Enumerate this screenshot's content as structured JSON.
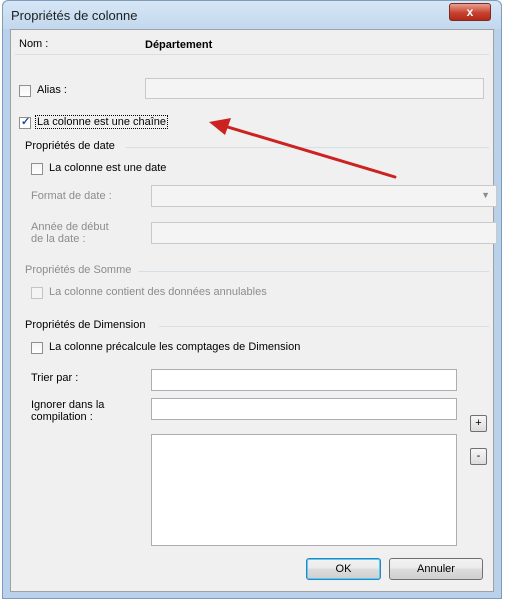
{
  "window": {
    "title": "Propriétés de colonne",
    "close_glyph": "x"
  },
  "name_row": {
    "label": "Nom :",
    "value": "Département"
  },
  "alias": {
    "label": "Alias :",
    "checked": false,
    "value": ""
  },
  "string_checkbox": {
    "label": "La colonne est une chaîne",
    "checked": true
  },
  "date_group": {
    "heading": "Propriétés de date",
    "is_date_label": "La colonne est une date",
    "format_label": "Format de date :",
    "format_value": "",
    "start_year_label_1": "Année de début",
    "start_year_label_2": "de la date :",
    "start_year_value": ""
  },
  "sum_group": {
    "heading": "Propriétés de Somme",
    "nullable_label": "La colonne contient des données annulables"
  },
  "dimension_group": {
    "heading": "Propriétés de Dimension",
    "precalc_label": "La colonne précalcule les comptages de Dimension",
    "sort_label": "Trier par :",
    "sort_value": "",
    "ignore_label_1": "Ignorer dans la",
    "ignore_label_2": "compilation :",
    "ignore_value": "",
    "add_glyph": "+",
    "remove_glyph": "-"
  },
  "buttons": {
    "ok": "OK",
    "cancel": "Annuler"
  },
  "arrow_color": "#cc2222"
}
